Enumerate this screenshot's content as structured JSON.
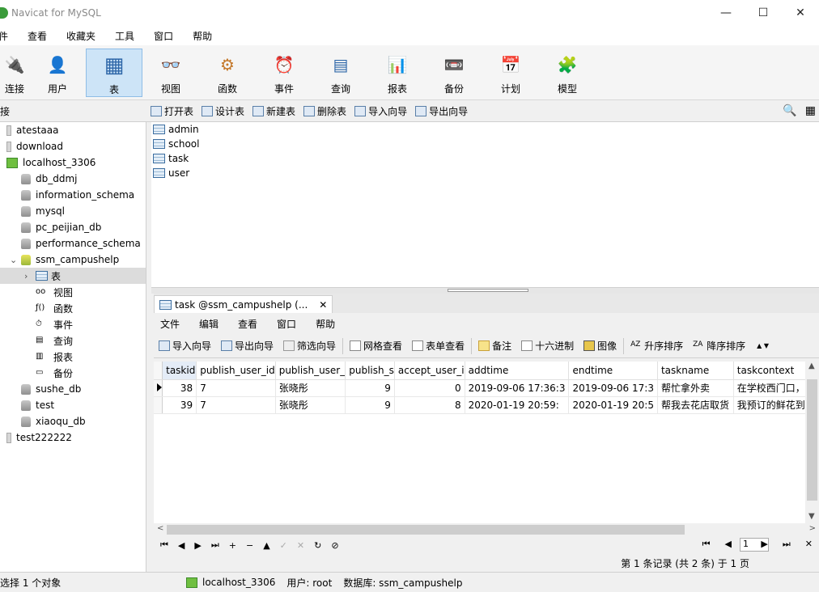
{
  "window": {
    "title": "Navicat for MySQL",
    "controls": [
      "—",
      "☐",
      "✕"
    ]
  },
  "menubar": [
    "件",
    "查看",
    "收藏夹",
    "工具",
    "窗口",
    "帮助"
  ],
  "toolbar": [
    {
      "label": "连接",
      "icon": "connect-icon",
      "glyph": "🔌"
    },
    {
      "label": "用户",
      "icon": "user-icon",
      "glyph": "👤"
    },
    {
      "label": "表",
      "icon": "table-icon",
      "glyph": "▦",
      "active": true
    },
    {
      "label": "视图",
      "icon": "view-icon",
      "glyph": "👓"
    },
    {
      "label": "函数",
      "icon": "function-icon",
      "glyph": "⚙"
    },
    {
      "label": "事件",
      "icon": "event-icon",
      "glyph": "⏰"
    },
    {
      "label": "查询",
      "icon": "query-icon",
      "glyph": "▤"
    },
    {
      "label": "报表",
      "icon": "report-icon",
      "glyph": "📊"
    },
    {
      "label": "备份",
      "icon": "backup-icon",
      "glyph": "📼"
    },
    {
      "label": "计划",
      "icon": "schedule-icon",
      "glyph": "📅"
    },
    {
      "label": "模型",
      "icon": "model-icon",
      "glyph": "🧩"
    }
  ],
  "subtoolbar": {
    "conn_label": "接",
    "buttons": [
      "打开表",
      "设计表",
      "新建表",
      "删除表",
      "导入向导",
      "导出向导"
    ],
    "right_glyphs": [
      "🔍",
      "▦"
    ]
  },
  "tree": [
    {
      "label": "atestaaa",
      "level": 0,
      "type": "conn"
    },
    {
      "label": "download",
      "level": 0,
      "type": "conn"
    },
    {
      "label": "localhost_3306",
      "level": 0,
      "type": "conn-on"
    },
    {
      "label": "db_ddmj",
      "level": 1,
      "type": "db"
    },
    {
      "label": "information_schema",
      "level": 1,
      "type": "db"
    },
    {
      "label": "mysql",
      "level": 1,
      "type": "db"
    },
    {
      "label": "pc_peijian_db",
      "level": 1,
      "type": "db"
    },
    {
      "label": "performance_schema",
      "level": 1,
      "type": "db"
    },
    {
      "label": "ssm_campushelp",
      "level": 1,
      "type": "db-open",
      "expander": "⌄"
    },
    {
      "label": "表",
      "level": 2,
      "type": "table",
      "expander": "›",
      "selected": true
    },
    {
      "label": "视图",
      "level": 2,
      "type": "glyph",
      "glyph": "oo"
    },
    {
      "label": "函数",
      "level": 2,
      "type": "glyph",
      "glyph": "ƒ()"
    },
    {
      "label": "事件",
      "level": 2,
      "type": "glyph",
      "glyph": "⏱"
    },
    {
      "label": "查询",
      "level": 2,
      "type": "glyph",
      "glyph": "▤"
    },
    {
      "label": "报表",
      "level": 2,
      "type": "glyph",
      "glyph": "▥"
    },
    {
      "label": "备份",
      "level": 2,
      "type": "glyph",
      "glyph": "▭"
    },
    {
      "label": "sushe_db",
      "level": 1,
      "type": "db"
    },
    {
      "label": "test",
      "level": 1,
      "type": "db"
    },
    {
      "label": "xiaoqu_db",
      "level": 1,
      "type": "db"
    },
    {
      "label": "test222222",
      "level": 0,
      "type": "conn"
    }
  ],
  "objects": [
    "admin",
    "school",
    "task",
    "user"
  ],
  "datatab": {
    "label": "task @ssm_campushelp (...",
    "close": "✕"
  },
  "innermenu": [
    "文件",
    "编辑",
    "查看",
    "窗口",
    "帮助"
  ],
  "innertoolbar": [
    "导入向导",
    "导出向导",
    "筛选向导",
    "网格查看",
    "表单查看",
    "备注",
    "十六进制",
    "图像",
    "升序排序",
    "降序排序"
  ],
  "innertoolbar_more": "▲ ▼",
  "grid": {
    "columns": [
      "taskid",
      "publish_user_id",
      "publish_user_",
      "publish_s",
      "accept_user_i",
      "addtime",
      "endtime",
      "taskname",
      "taskcontext"
    ],
    "rows": [
      [
        "38",
        "7",
        "张晓彤",
        "9",
        "0",
        "2019-09-06 17:36:3",
        "2019-09-06 17:3",
        "帮忙拿外卖",
        "在学校西门口，耶"
      ],
      [
        "39",
        "7",
        "张晓彤",
        "9",
        "8",
        "2020-01-19 20:59:",
        "2020-01-19 20:5",
        "帮我去花店取货",
        "我预订的鲜花到给"
      ]
    ]
  },
  "scroll": {
    "up": "▲",
    "down": "▼",
    "left": "<",
    "right": ">"
  },
  "navbar": {
    "left": [
      "⏮",
      "◀",
      "▶",
      "⏭",
      "+",
      "−",
      "▲",
      "✓",
      "✕",
      "↻",
      "⊘"
    ],
    "right_prev": [
      "⏮",
      "◀"
    ],
    "page": "1",
    "right_next": [
      "▶",
      "⏭",
      "✕"
    ]
  },
  "record_info": "第 1 条记录 (共 2 条) 于 1 页",
  "status": {
    "selection": "选择 1 个对象",
    "connection": "localhost_3306",
    "user": "用户: root",
    "database": "数据库: ssm_campushelp"
  }
}
